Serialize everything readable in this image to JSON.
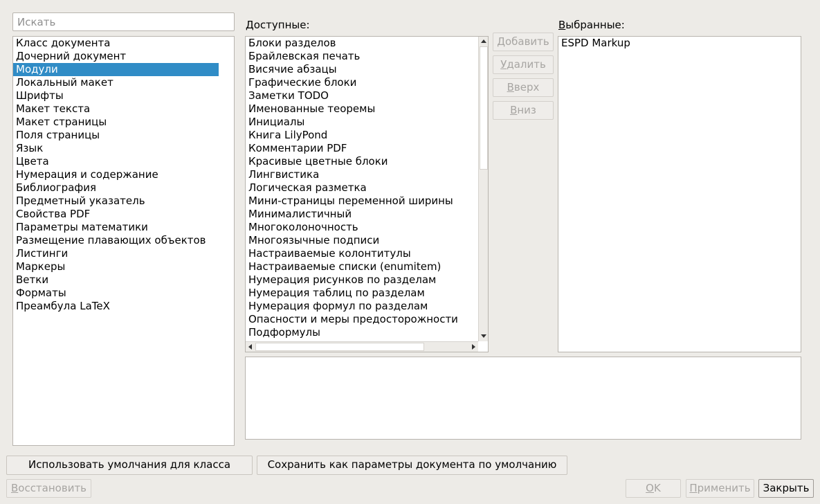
{
  "search": {
    "placeholder": "Искать"
  },
  "categories": {
    "items": [
      "Класс документа",
      "Дочерний документ",
      "Модули",
      "Локальный макет",
      "Шрифты",
      "Макет текста",
      "Макет страницы",
      "Поля страницы",
      "Язык",
      "Цвета",
      "Нумерация и содержание",
      "Библиография",
      "Предметный указатель",
      "Свойства PDF",
      "Параметры математики",
      "Размещение плавающих объектов",
      "Листинги",
      "Маркеры",
      "Ветки",
      "Форматы",
      "Преамбула LaTeX"
    ],
    "selected": "Модули"
  },
  "available": {
    "label": "Доступные:",
    "items": [
      "Блоки разделов",
      "Брайлевская печать",
      "Висячие абзацы",
      "Графические блоки",
      "Заметки TODO",
      "Именованные теоремы",
      "Инициалы",
      "Книга LilyPond",
      "Комментарии PDF",
      "Красивые цветные блоки",
      "Лингвистика",
      "Логическая разметка",
      "Мини-страницы переменной ширины",
      "Минималистичный",
      "Многоколоночность",
      "Многоязычные подписи",
      "Настраиваемые колонтитулы",
      "Настраиваемые списки (enumitem)",
      "Нумерация рисунков по разделам",
      "Нумерация таблиц по разделам",
      "Нумерация формул по разделам",
      "Опасности и меры предосторожности",
      "Подформулы"
    ]
  },
  "module_buttons": {
    "add": {
      "first": "Д",
      "rest": "обавить"
    },
    "remove": {
      "first": "У",
      "rest": "далить"
    },
    "up": {
      "first": "В",
      "rest": "верх"
    },
    "down": {
      "first": "В",
      "rest": "низ"
    }
  },
  "selected_modules": {
    "label_first": "В",
    "label_rest": "ыбранные:",
    "items": [
      "ESPD Markup"
    ]
  },
  "description": {
    "text": ""
  },
  "footer": {
    "use_class_defaults": "Использовать умолчания для класса",
    "save_as_defaults": "Сохранить как параметры документа по умолчанию",
    "restore": {
      "first": "В",
      "rest": "осстановить"
    },
    "ok": {
      "first": "O",
      "rest": "K"
    },
    "apply": {
      "first": "П",
      "rest": "рименить"
    },
    "close": "Закрыть"
  },
  "colors": {
    "selection": "#308cc6",
    "window_bg": "#edebe7",
    "disabled_text": "#a7a5a2"
  }
}
